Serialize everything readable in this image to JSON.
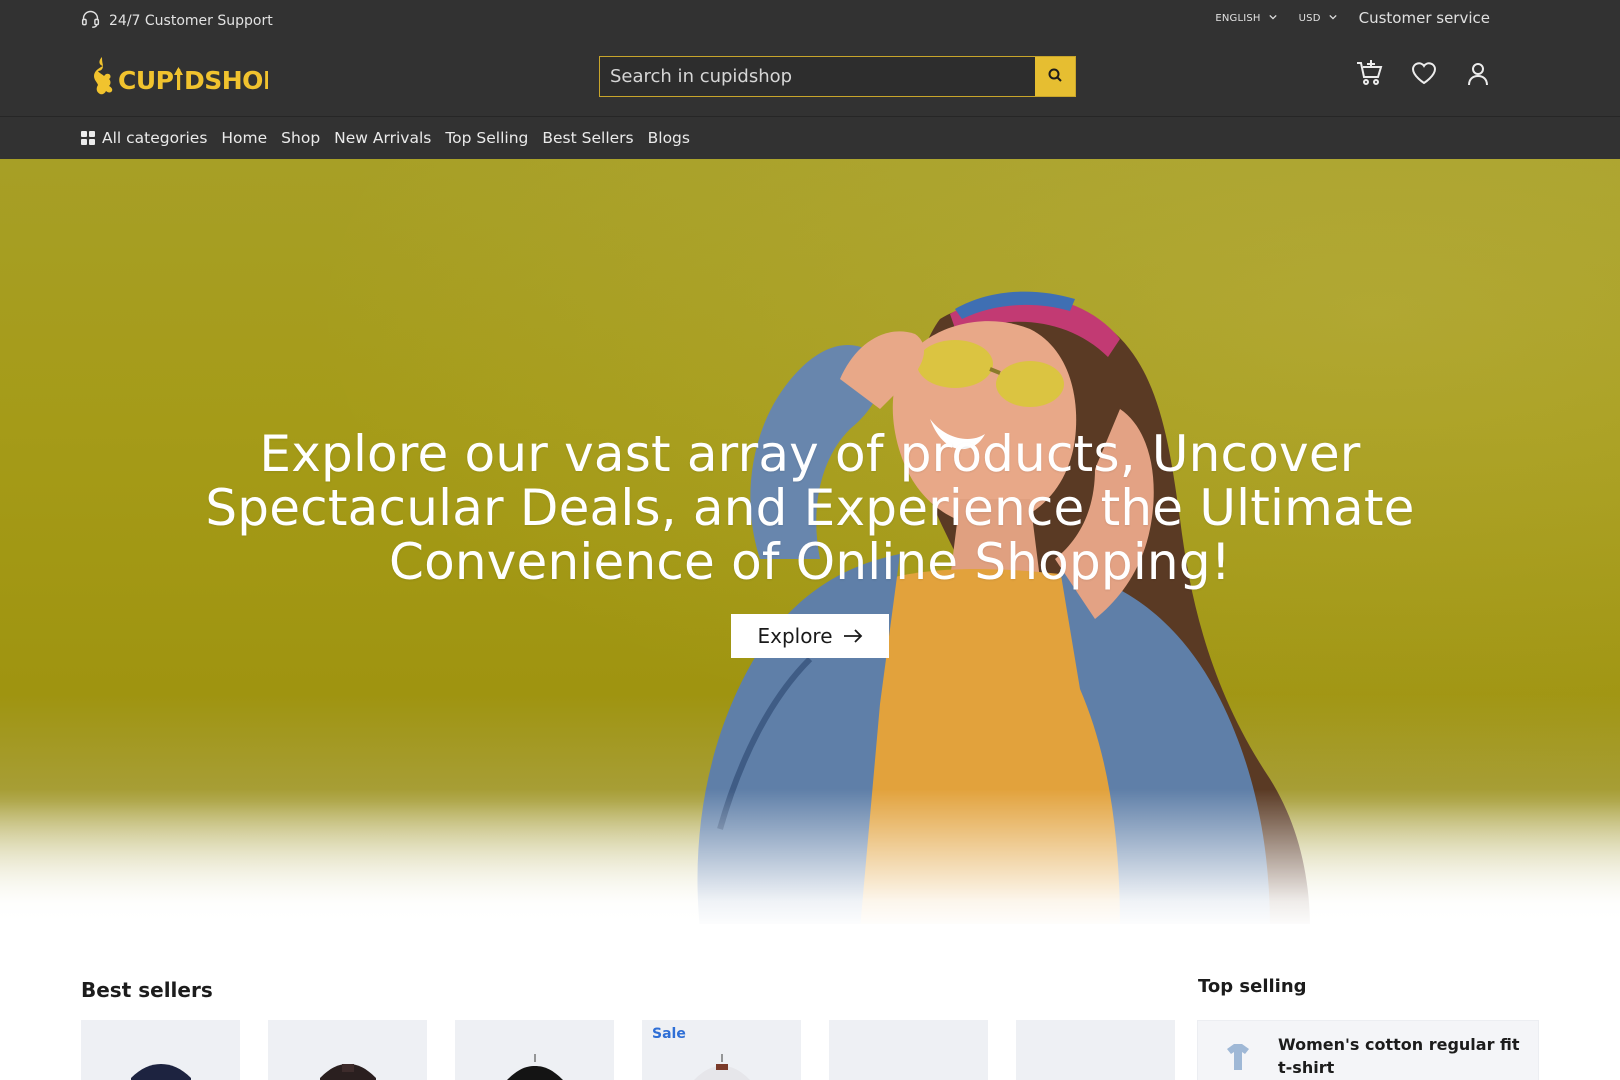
{
  "topbar": {
    "support_label": "24/7 Customer Support",
    "language": "ENGLISH",
    "currency": "USD",
    "customer_service": "Customer service"
  },
  "header": {
    "logo_text": "CUP DSHOP",
    "search_placeholder": "Search in cupidshop",
    "icons": [
      "search-icon",
      "cart-icon",
      "heart-icon",
      "user-icon"
    ],
    "accent_color": "#e6be31"
  },
  "nav": {
    "items": [
      "All categories",
      "Home",
      "Shop",
      "New Arrivals",
      "Top Selling",
      "Best Sellers",
      "Blogs"
    ]
  },
  "hero": {
    "headline": "Explore our vast array of products, Uncover Spectacular Deals, and Experience the Ultimate Convenience of Online Shopping!",
    "cta_label": "Explore",
    "background_color": "#a59b18"
  },
  "best_sellers": {
    "title": "Best sellers",
    "cards": [
      {
        "badge": ""
      },
      {
        "badge": ""
      },
      {
        "badge": ""
      },
      {
        "badge": "Sale"
      },
      {
        "badge": ""
      },
      {
        "badge": ""
      }
    ]
  },
  "top_selling": {
    "title": "Top selling",
    "items": [
      {
        "name": "Women's cotton regular fit t-shirt"
      }
    ]
  }
}
